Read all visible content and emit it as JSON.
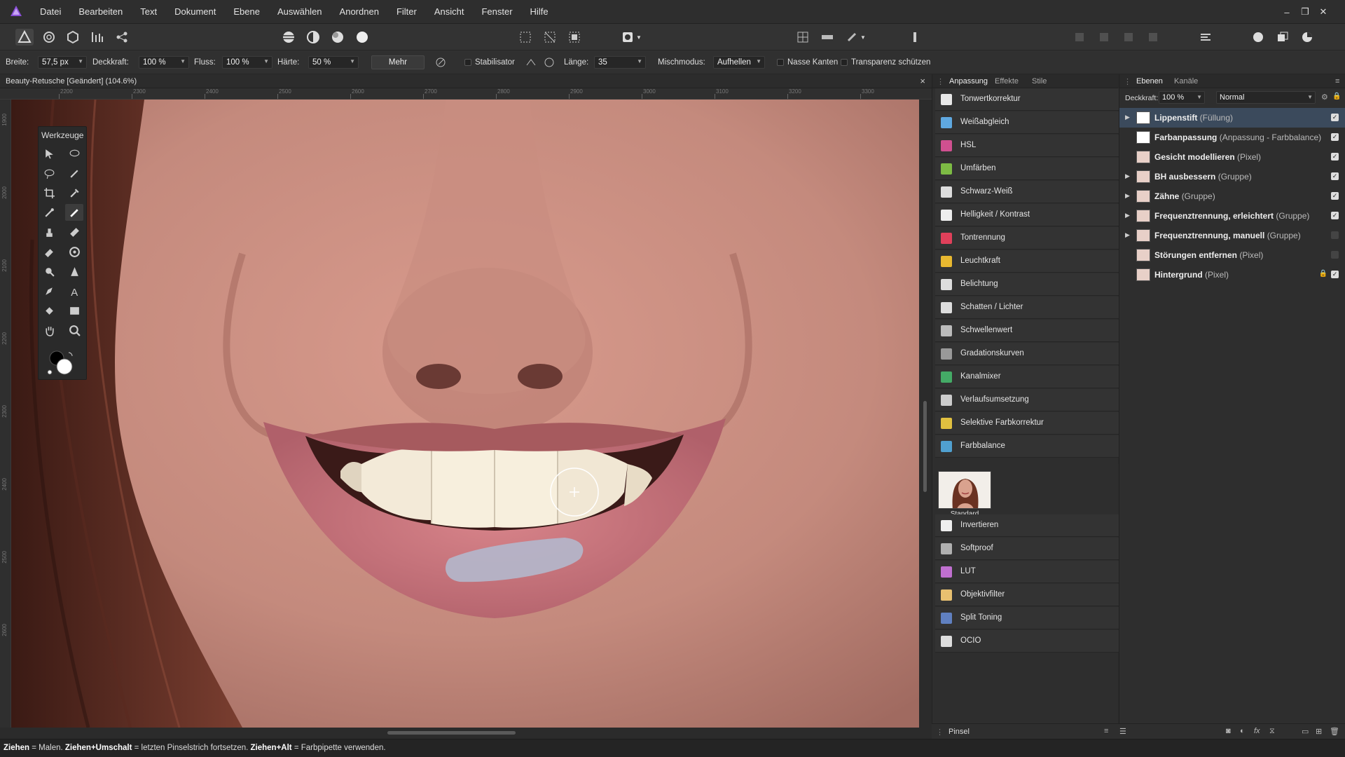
{
  "menubar": {
    "items": [
      "Datei",
      "Bearbeiten",
      "Text",
      "Dokument",
      "Ebene",
      "Auswählen",
      "Anordnen",
      "Filter",
      "Ansicht",
      "Fenster",
      "Hilfe"
    ]
  },
  "window_controls": [
    "–",
    "❐",
    "✕"
  ],
  "context_bar": {
    "breite_label": "Breite:",
    "breite_value": "57,5 px",
    "deckkraft_label": "Deckkraft:",
    "deckkraft_value": "100 %",
    "fluss_label": "Fluss:",
    "fluss_value": "100 %",
    "haerte_label": "Härte:",
    "haerte_value": "50 %",
    "mehr_label": "Mehr",
    "stabilisator_label": "Stabilisator",
    "laenge_label": "Länge:",
    "laenge_value": "35",
    "mischmodus_label": "Mischmodus:",
    "mischmodus_value": "Aufhellen",
    "nasse_kanten_label": "Nasse Kanten",
    "transparenz_label": "Transparenz schützen"
  },
  "document": {
    "tab_title": "Beauty-Retusche [Geändert] (104.6%)",
    "close": "×"
  },
  "ruler": {
    "h_ticks": [
      "2200",
      "2300",
      "2400",
      "2500",
      "2600",
      "2700",
      "2800",
      "2900",
      "3000",
      "3100",
      "3200",
      "3300"
    ],
    "v_ticks": [
      "1900",
      "2000",
      "2100",
      "2200",
      "2300",
      "2400",
      "2500",
      "2600"
    ]
  },
  "tools_panel": {
    "title": "Werkzeuge"
  },
  "adjustments_panel": {
    "tabs": [
      "Anpassung",
      "Effekte",
      "Stile"
    ],
    "items": [
      {
        "label": "Tonwertkorrektur",
        "color": "#e8e8e8"
      },
      {
        "label": "Weißabgleich",
        "color": "#5fa8e0"
      },
      {
        "label": "HSL",
        "color": "#d05090"
      },
      {
        "label": "Umfärben",
        "color": "#7dbb44"
      },
      {
        "label": "Schwarz-Weiß",
        "color": "#dddddd"
      },
      {
        "label": "Helligkeit / Kontrast",
        "color": "#eeeeee"
      },
      {
        "label": "Tontrennung",
        "color": "#e0405a"
      },
      {
        "label": "Leuchtkraft",
        "color": "#e8b830"
      },
      {
        "label": "Belichtung",
        "color": "#dddddd"
      },
      {
        "label": "Schatten / Lichter",
        "color": "#dddddd"
      },
      {
        "label": "Schwellenwert",
        "color": "#bbbbbb"
      },
      {
        "label": "Gradationskurven",
        "color": "#999999"
      },
      {
        "label": "Kanalmixer",
        "color": "#44aa66"
      },
      {
        "label": "Verlaufsumsetzung",
        "color": "#cccccc"
      },
      {
        "label": "Selektive Farbkorrektur",
        "color": "#e0c040"
      },
      {
        "label": "Farbbalance",
        "color": "#50a0d0"
      }
    ],
    "preset_caption": "Standard",
    "items_after": [
      {
        "label": "Invertieren",
        "color": "#eeeeee"
      },
      {
        "label": "Softproof",
        "color": "#b0b0b0"
      },
      {
        "label": "LUT",
        "color": "#c070d0"
      },
      {
        "label": "Objektivfilter",
        "color": "#e8c070"
      },
      {
        "label": "Split Toning",
        "color": "#6080c0"
      },
      {
        "label": "OCIO",
        "color": "#dddddd"
      }
    ]
  },
  "layers_panel": {
    "tabs": [
      "Ebenen",
      "Kanäle"
    ],
    "deckkraft_label": "Deckkraft:",
    "deckkraft_value": "100 %",
    "blend_mode": "Normal",
    "layers": [
      {
        "name": "Lippenstift",
        "type": "(Füllung)",
        "selected": true,
        "expander": "▶",
        "visible": true
      },
      {
        "name": "Farbanpassung",
        "type": "(Anpassung - Farbbalance)",
        "selected": false,
        "expander": "",
        "visible": true
      },
      {
        "name": "Gesicht modellieren",
        "type": "(Pixel)",
        "selected": false,
        "expander": "",
        "visible": true
      },
      {
        "name": "BH ausbessern",
        "type": "(Gruppe)",
        "selected": false,
        "expander": "▶",
        "visible": true
      },
      {
        "name": "Zähne",
        "type": "(Gruppe)",
        "selected": false,
        "expander": "▶",
        "visible": true
      },
      {
        "name": "Frequenztrennung, erleichtert",
        "type": "(Gruppe)",
        "selected": false,
        "expander": "▶",
        "visible": true
      },
      {
        "name": "Frequenztrennung, manuell",
        "type": "(Gruppe)",
        "selected": false,
        "expander": "▶",
        "visible": false
      },
      {
        "name": "Störungen entfernen",
        "type": "(Pixel)",
        "selected": false,
        "expander": "",
        "visible": false
      },
      {
        "name": "Hintergrund",
        "type": "(Pixel)",
        "selected": false,
        "expander": "",
        "visible": true,
        "locked": true
      }
    ],
    "check": "✓",
    "lock": "🔒"
  },
  "bottom": {
    "pinsel_label": "Pinsel"
  },
  "status": {
    "k1": "Ziehen",
    "t1": " = Malen. ",
    "k2": "Ziehen+Umschalt",
    "t2": " = letzten Pinselstrich fortsetzen. ",
    "k3": "Ziehen+Alt",
    "t3": " = Farbpipette verwenden."
  },
  "colors": {
    "accent": "#8a4fd8",
    "selection": "#3b4a5c",
    "brush_preview": "#b4b4c8"
  }
}
